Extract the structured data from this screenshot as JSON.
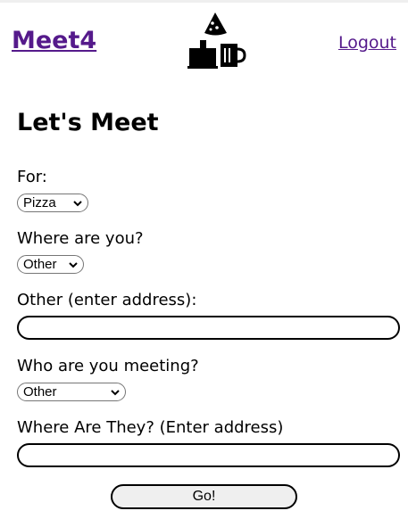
{
  "header": {
    "brand": "Meet4",
    "logout_label": "Logout",
    "logo_icon": "pizza-and-coffee-logo-icon"
  },
  "form": {
    "title": "Let's Meet",
    "for_label": "For:",
    "for_value": "Pizza",
    "location_label": "Where are you?",
    "location_value": "Other",
    "other_address_label": "Other (enter address):",
    "other_address_value": "",
    "meeting_label": "Who are you meeting?",
    "meeting_value": "Other",
    "their_address_label": "Where Are They? (Enter address)",
    "their_address_value": "",
    "submit_label": "Go!"
  },
  "colors": {
    "link": "#551a8b",
    "button_bg": "#efefef"
  }
}
